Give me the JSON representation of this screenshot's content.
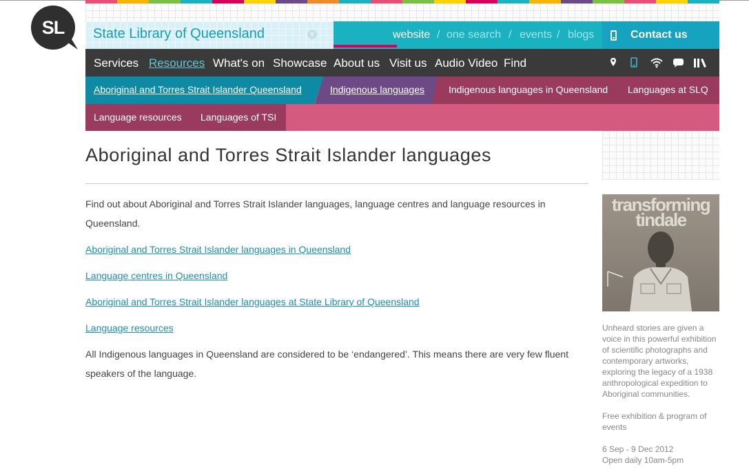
{
  "brand": {
    "logo_text": "SL",
    "site_title": "State Library of Queensland",
    "colors": {
      "teal": "#1ab1c0",
      "dark_nav": "#3a3a3a",
      "pink": "#d45a80",
      "maroon": "#9a3a5c",
      "purple": "#6d4a86",
      "link": "#1a8fb0"
    }
  },
  "search_tabs": {
    "items": [
      "website",
      "one search",
      "events",
      "blogs"
    ],
    "separator": "/",
    "active": "website"
  },
  "contact": {
    "label": "Contact us",
    "icon": "mobile-phone-icon"
  },
  "main_nav": {
    "items": [
      "Services",
      "Resources",
      "What's on",
      "Showcase",
      "About us",
      "Visit us",
      "Audio Video",
      "Find"
    ],
    "active": "Resources",
    "icons": [
      "map-pin-icon",
      "mobile-icon",
      "wifi-icon",
      "chat-icon",
      "library-books-icon"
    ]
  },
  "sub_nav": {
    "row1": [
      "Aboriginal and Torres Strait Islander Queensland",
      "Indigenous languages",
      "Indigenous languages in Queensland",
      "Languages at SLQ"
    ],
    "row2": [
      "Language resources",
      "Languages of TSI"
    ]
  },
  "content": {
    "title": "Aboriginal and Torres Strait Islander languages",
    "intro": "Find out about Aboriginal and Torres Strait Islander languages, language centres and language resources in Queensland.",
    "links": [
      "Aboriginal and Torres Strait Islander languages in Queensland",
      "Language centres in Queensland",
      "Aboriginal and Torres Strait Islander languages at State Library of Queensland",
      "Language resources"
    ],
    "note": "All Indigenous languages in Queensland are considered to be ‘endangered’.  This means there are very few fluent speakers of the language."
  },
  "sidebar": {
    "promo_title_line1": "transforming",
    "promo_title_line2": "tindale",
    "description": "Unheard stories are given a voice in this powerful exhibition of scientific photographs and contemporary artworks, exploring the legacy of a 1938 anthropological expedition to Aboriginal communities.",
    "free_text": "Free exhibition & program of events",
    "dates": "6 Sep - 9 Dec 2012",
    "hours": "Open daily 10am-5pm"
  }
}
